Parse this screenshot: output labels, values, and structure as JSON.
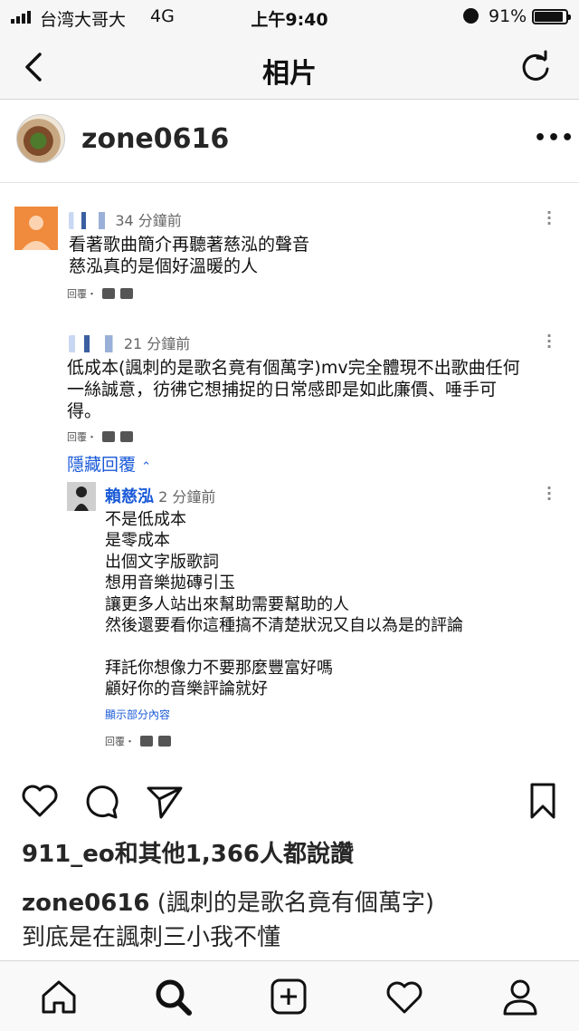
{
  "status_bar": {
    "carrier": "台湾大哥大",
    "network": "4G",
    "time": "上午9:40",
    "battery": "91%",
    "battery_level": 0.91
  },
  "nav": {
    "title": "相片",
    "back_icon": "chevron-left-icon",
    "refresh_icon": "refresh-icon"
  },
  "post": {
    "username": "zone0616",
    "more_icon": "more-horizontal-icon"
  },
  "comments": [
    {
      "time": "34 分鐘前",
      "text": "看著歌曲簡介再聽著慈泓的聲音\n慈泓真的是個好溫暖的人",
      "reply_label": "回覆・"
    },
    {
      "time": "21 分鐘前",
      "text": "低成本(諷刺的是歌名竟有個萬字)mv完全體現不出歌曲任何\n一絲誠意，彷彿它想捕捉的日常感即是如此廉價、唾手可\n得。",
      "reply_label": "回覆・",
      "hide_replies": "隱藏回覆",
      "replies": [
        {
          "author": "賴慈泓",
          "time": "2 分鐘前",
          "text": "不是低成本\n是零成本\n出個文字版歌詞\n想用音樂拋磚引玉\n讓更多人站出來幫助需要幫助的人\n然後還要看你這種搞不清楚狀況又自以為是的評論\n\n拜託你想像力不要那麼豐富好嗎\n顧好你的音樂評論就好",
          "show_more": "顯示部分內容",
          "reply_label": "回覆・"
        }
      ]
    }
  ],
  "actions": {
    "like_icon": "heart-icon",
    "comment_icon": "comment-icon",
    "share_icon": "send-icon",
    "save_icon": "bookmark-icon"
  },
  "likes_text": "911_eo和其他1,366人都說讚",
  "caption": {
    "user": "zone0616",
    "text": "(諷刺的是歌名竟有個萬字)\n到底是在諷刺三小我不懂"
  },
  "tabbar": [
    "home-icon",
    "search-icon",
    "add-post-icon",
    "activity-heart-icon",
    "profile-icon"
  ]
}
